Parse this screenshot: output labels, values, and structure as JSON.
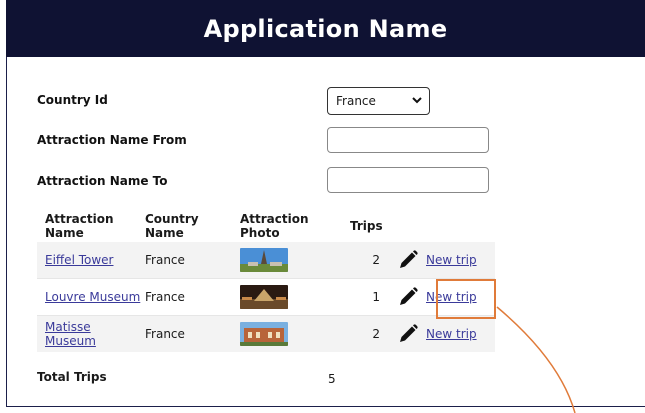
{
  "header": {
    "title": "Application Name"
  },
  "form": {
    "country_id_label": "Country Id",
    "country_selected": "France",
    "attraction_from_label": "Attraction Name From",
    "attraction_to_label": "Attraction Name To",
    "attraction_from_value": "",
    "attraction_to_value": ""
  },
  "grid": {
    "columns": [
      "Attraction Name",
      "Country Name",
      "Attraction Photo",
      "Trips",
      "",
      ""
    ],
    "rows": [
      {
        "name": "Eiffel Tower",
        "country": "France",
        "trips": "2",
        "action": "New trip"
      },
      {
        "name": "Louvre Museum",
        "country": "France",
        "trips": "1",
        "action": "New trip"
      },
      {
        "name": "Matisse Museum",
        "country": "France",
        "trips": "2",
        "action": "New trip"
      }
    ]
  },
  "footer": {
    "total_label": "Total Trips",
    "total_value": "5"
  },
  "colors": {
    "header_bg": "#0f1233",
    "accent": "#e07b3a",
    "link": "#3a3a9a"
  },
  "icons": {
    "edit": "pencil-icon",
    "dropdown": "chevron-down-icon"
  }
}
